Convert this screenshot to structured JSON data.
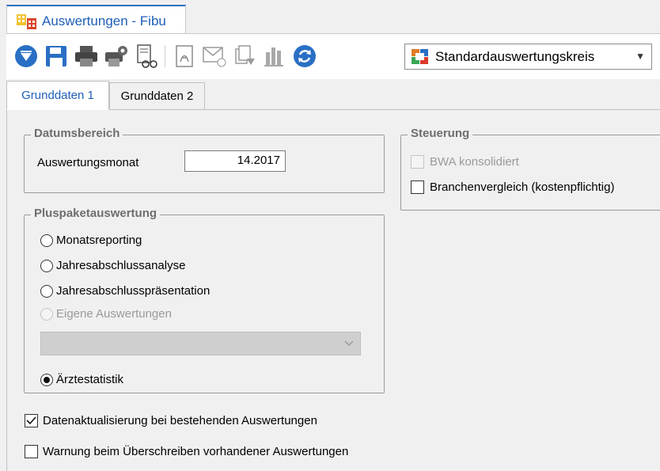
{
  "window": {
    "title": "Auswertungen - Fibu"
  },
  "toolbar": {
    "icons": [
      "arrow-down-circle-icon",
      "save-icon",
      "print-icon",
      "print-settings-icon",
      "preview-glasses-icon",
      "pdf-icon",
      "email-icon",
      "export-icon",
      "chart-icon",
      "refresh-icon"
    ],
    "combo_value": "Standardauswertungskreis",
    "accent": "#2a6fc4"
  },
  "tabs": [
    {
      "label": "Grunddaten 1",
      "active": true
    },
    {
      "label": "Grunddaten 2",
      "active": false
    }
  ],
  "datumsbereich": {
    "legend": "Datumsbereich",
    "label": "Auswertungsmonat",
    "value": "14.2017"
  },
  "steuerung": {
    "legend": "Steuerung",
    "bwa_label": "BWA konsolidiert",
    "branchen_label": "Branchenvergleich (kostenpflichtig)"
  },
  "pluspaket": {
    "legend": "Pluspaketauswertung",
    "options": [
      "Monatsreporting",
      "Jahresabschlussanalyse",
      "Jahresabschlusspräsentation",
      "Eigene Auswertungen",
      "Ärztestatistik"
    ],
    "selected": "Ärztestatistik"
  },
  "bottom": {
    "datenaktualisierung_label": "Datenaktualisierung bei bestehenden Auswertungen",
    "warnung_label": "Warnung beim Überschreiben vorhandener Auswertungen"
  }
}
